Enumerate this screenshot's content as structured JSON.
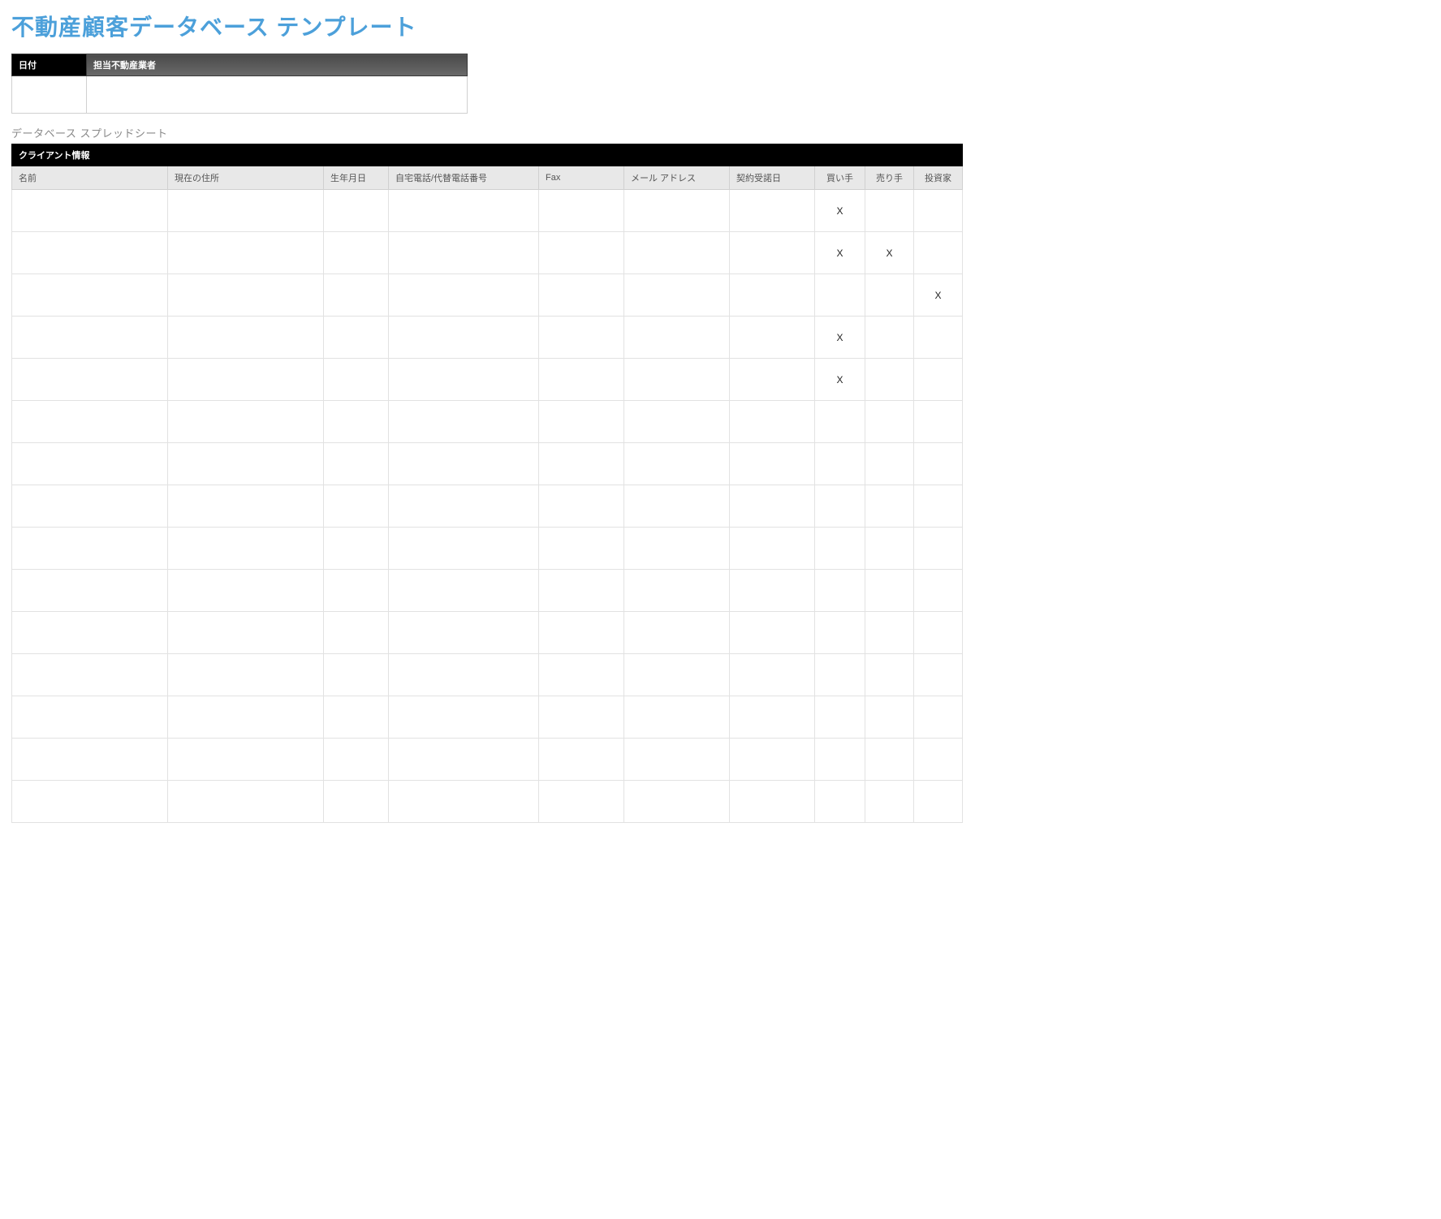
{
  "title": "不動産顧客データベース テンプレート",
  "meta": {
    "date_label": "日付",
    "agent_label": "担当不動産業者",
    "date_value": "",
    "agent_value": ""
  },
  "subtitle": "データベース スプレッドシート",
  "group_header": "クライアント情報",
  "columns": {
    "name": "名前",
    "address": "現在の住所",
    "dob": "生年月日",
    "phone": "自宅電話/代替電話番号",
    "fax": "Fax",
    "email": "メール アドレス",
    "engagement_date": "契約受諾日",
    "buyer": "買い手",
    "seller": "売り手",
    "investor": "投資家"
  },
  "mark": "X",
  "rows": [
    {
      "name": "",
      "address": "",
      "dob": "",
      "phone": "",
      "fax": "",
      "email": "",
      "engagement_date": "",
      "buyer": "X",
      "seller": "",
      "investor": ""
    },
    {
      "name": "",
      "address": "",
      "dob": "",
      "phone": "",
      "fax": "",
      "email": "",
      "engagement_date": "",
      "buyer": "X",
      "seller": "X",
      "investor": ""
    },
    {
      "name": "",
      "address": "",
      "dob": "",
      "phone": "",
      "fax": "",
      "email": "",
      "engagement_date": "",
      "buyer": "",
      "seller": "",
      "investor": "X"
    },
    {
      "name": "",
      "address": "",
      "dob": "",
      "phone": "",
      "fax": "",
      "email": "",
      "engagement_date": "",
      "buyer": "X",
      "seller": "",
      "investor": ""
    },
    {
      "name": "",
      "address": "",
      "dob": "",
      "phone": "",
      "fax": "",
      "email": "",
      "engagement_date": "",
      "buyer": "X",
      "seller": "",
      "investor": ""
    },
    {
      "name": "",
      "address": "",
      "dob": "",
      "phone": "",
      "fax": "",
      "email": "",
      "engagement_date": "",
      "buyer": "",
      "seller": "",
      "investor": ""
    },
    {
      "name": "",
      "address": "",
      "dob": "",
      "phone": "",
      "fax": "",
      "email": "",
      "engagement_date": "",
      "buyer": "",
      "seller": "",
      "investor": ""
    },
    {
      "name": "",
      "address": "",
      "dob": "",
      "phone": "",
      "fax": "",
      "email": "",
      "engagement_date": "",
      "buyer": "",
      "seller": "",
      "investor": ""
    },
    {
      "name": "",
      "address": "",
      "dob": "",
      "phone": "",
      "fax": "",
      "email": "",
      "engagement_date": "",
      "buyer": "",
      "seller": "",
      "investor": ""
    },
    {
      "name": "",
      "address": "",
      "dob": "",
      "phone": "",
      "fax": "",
      "email": "",
      "engagement_date": "",
      "buyer": "",
      "seller": "",
      "investor": ""
    },
    {
      "name": "",
      "address": "",
      "dob": "",
      "phone": "",
      "fax": "",
      "email": "",
      "engagement_date": "",
      "buyer": "",
      "seller": "",
      "investor": ""
    },
    {
      "name": "",
      "address": "",
      "dob": "",
      "phone": "",
      "fax": "",
      "email": "",
      "engagement_date": "",
      "buyer": "",
      "seller": "",
      "investor": ""
    },
    {
      "name": "",
      "address": "",
      "dob": "",
      "phone": "",
      "fax": "",
      "email": "",
      "engagement_date": "",
      "buyer": "",
      "seller": "",
      "investor": ""
    },
    {
      "name": "",
      "address": "",
      "dob": "",
      "phone": "",
      "fax": "",
      "email": "",
      "engagement_date": "",
      "buyer": "",
      "seller": "",
      "investor": ""
    },
    {
      "name": "",
      "address": "",
      "dob": "",
      "phone": "",
      "fax": "",
      "email": "",
      "engagement_date": "",
      "buyer": "",
      "seller": "",
      "investor": ""
    }
  ]
}
